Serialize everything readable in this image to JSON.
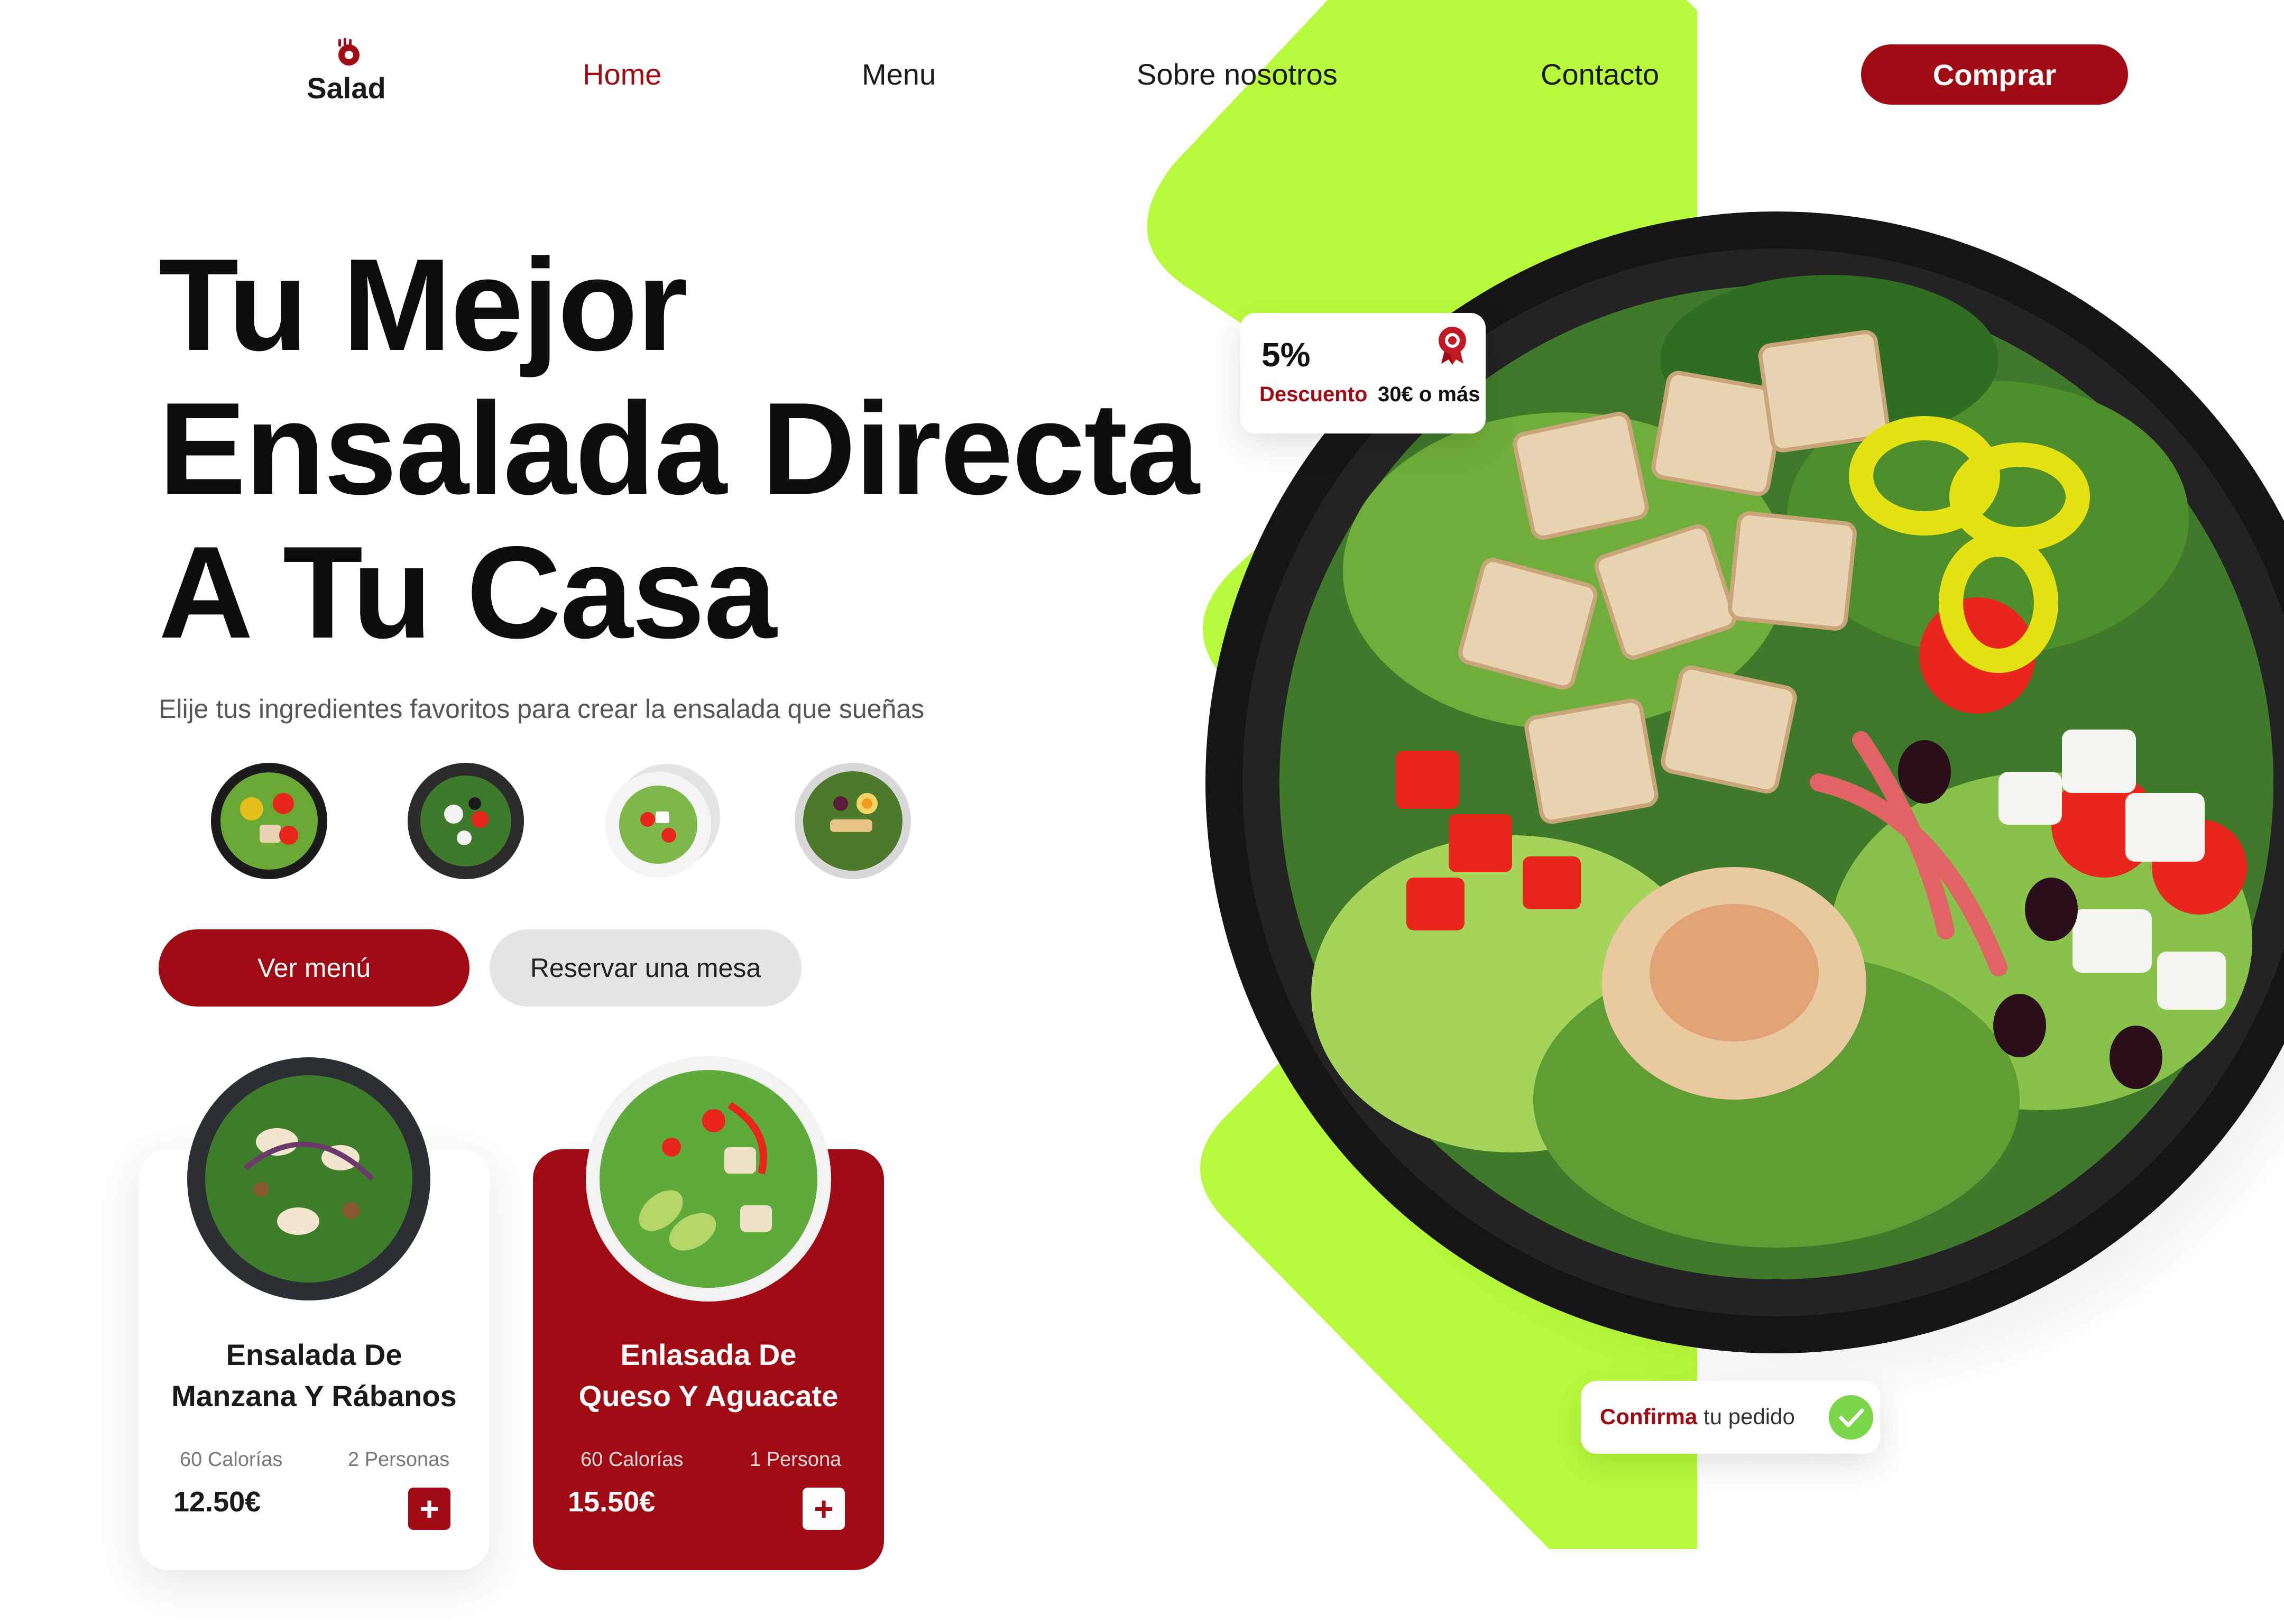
{
  "brand": {
    "name": "Salad",
    "accent": "#a00a13",
    "lime": "#b8fb3c"
  },
  "nav": {
    "items": [
      {
        "label": "Home",
        "active": true
      },
      {
        "label": "Menu",
        "active": false
      },
      {
        "label": "Sobre nosotros",
        "active": false
      },
      {
        "label": "Contacto",
        "active": false
      }
    ],
    "cta": "Comprar"
  },
  "hero": {
    "title_lines": [
      "Tu Mejor",
      "Ensalada Directa",
      "A Tu Casa"
    ],
    "subtitle": "Elije tus ingredientes favoritos para crear la ensalada que sueñas",
    "thumbnails": [
      "salad-thumb-1",
      "salad-thumb-2",
      "salad-thumb-3",
      "salad-thumb-4"
    ],
    "primary_button": "Ver menú",
    "secondary_button": "Reservar una mesa"
  },
  "discount": {
    "percent": "5%",
    "label": "Descuento",
    "threshold": "30€ o más",
    "icon": "award-icon"
  },
  "confirm": {
    "strong": "Confirma",
    "rest": " tu pedido",
    "icon": "check-icon"
  },
  "products": [
    {
      "title_lines": [
        "Ensalada De",
        "Manzana Y Rábanos"
      ],
      "calories": "60 Calorías",
      "servings": "2 Personas",
      "price": "12.50€",
      "add_icon": "plus-icon",
      "highlighted": false
    },
    {
      "title_lines": [
        "Enlasada De",
        "Queso Y Aguacate"
      ],
      "calories": "60 Calorías",
      "servings": "1 Persona",
      "price": "15.50€",
      "add_icon": "plus-icon",
      "highlighted": true
    }
  ]
}
